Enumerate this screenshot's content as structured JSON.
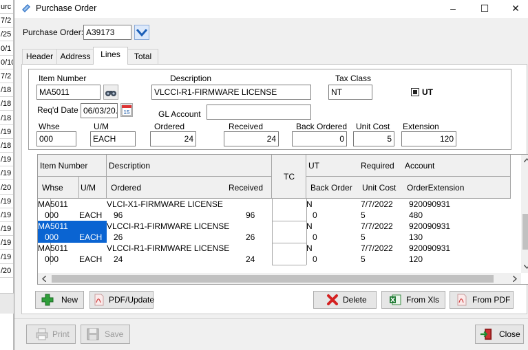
{
  "background_app": {
    "cells": [
      "urc",
      "7/2",
      "/25",
      "0/1",
      "0/10",
      "7/2",
      "/18",
      "/18",
      "/18",
      "/19",
      "/18",
      "/19",
      "/19",
      "/20",
      "/19",
      "/19",
      "/19",
      "/19",
      "/19",
      "/20"
    ]
  },
  "window": {
    "title": "Purchase Order",
    "minimize": "–",
    "maximize": "☐",
    "close": "✕"
  },
  "po": {
    "label": "Purchase Order:",
    "value": "A39173"
  },
  "tabs": [
    "Header",
    "Address",
    "Lines",
    "Total"
  ],
  "active_tab": "Lines",
  "form": {
    "item_number_label": "Item Number",
    "item_number": "MA5011",
    "description_label": "Description",
    "description": "VLCCI-R1-FIRMWARE LICENSE",
    "tax_class_label": "Tax Class",
    "tax_class": "NT",
    "ut_label": "UT",
    "ut_checked": true,
    "reqd_date_label": "Req'd Date",
    "reqd_date": "06/03/20.",
    "gl_account_label": "GL Account",
    "gl_account": "",
    "whse_label": "Whse",
    "whse": "000",
    "um_label": "U/M",
    "um": "EACH",
    "ordered_label": "Ordered",
    "ordered": "24",
    "received_label": "Received",
    "received": "24",
    "back_ordered_label": "Back Ordered",
    "back_ordered": "0",
    "unit_cost_label": "Unit Cost",
    "unit_cost": "5",
    "extension_label": "Extension",
    "extension": "120"
  },
  "grid": {
    "headers": {
      "item_number": "Item Number",
      "description": "Description",
      "tc": "TC",
      "ut": "UT",
      "required": "Required",
      "account": "Account",
      "whse": "Whse",
      "um": "U/M",
      "ordered": "Ordered",
      "received": "Received",
      "back_order": "Back Order",
      "unit_cost": "Unit Cost",
      "order_extension": "OrderExtension"
    },
    "rows": [
      {
        "item": "MA5011",
        "whse": "000",
        "um": "EACH",
        "desc": "VLCI-X1-FIRMWARE LICENSE",
        "ordered": "96",
        "received": "96",
        "ut": "N",
        "back_order": "0",
        "required": "7/7/2022",
        "unit_cost": "5",
        "account": "920090931",
        "extension": "480"
      },
      {
        "item": "MA5011",
        "whse": "000",
        "um": "EACH",
        "desc": "VLCCI-R1-FIRMWARE LICENSE",
        "ordered": "26",
        "received": "26",
        "ut": "N",
        "back_order": "0",
        "required": "7/7/2022",
        "unit_cost": "5",
        "account": "920090931",
        "extension": "130"
      },
      {
        "item": "MA5011",
        "whse": "000",
        "um": "EACH",
        "desc": "VLCCI-R1-FIRMWARE LICENSE",
        "ordered": "24",
        "received": "24",
        "ut": "N",
        "back_order": "0",
        "required": "7/7/2022",
        "unit_cost": "5",
        "account": "920090931",
        "extension": "120"
      }
    ]
  },
  "buttons": {
    "new": "New",
    "pdf_update": "PDF/Update",
    "delete": "Delete",
    "from_xls": "From Xls",
    "from_pdf": "From PDF",
    "print": "Print",
    "save": "Save",
    "close": "Close"
  }
}
